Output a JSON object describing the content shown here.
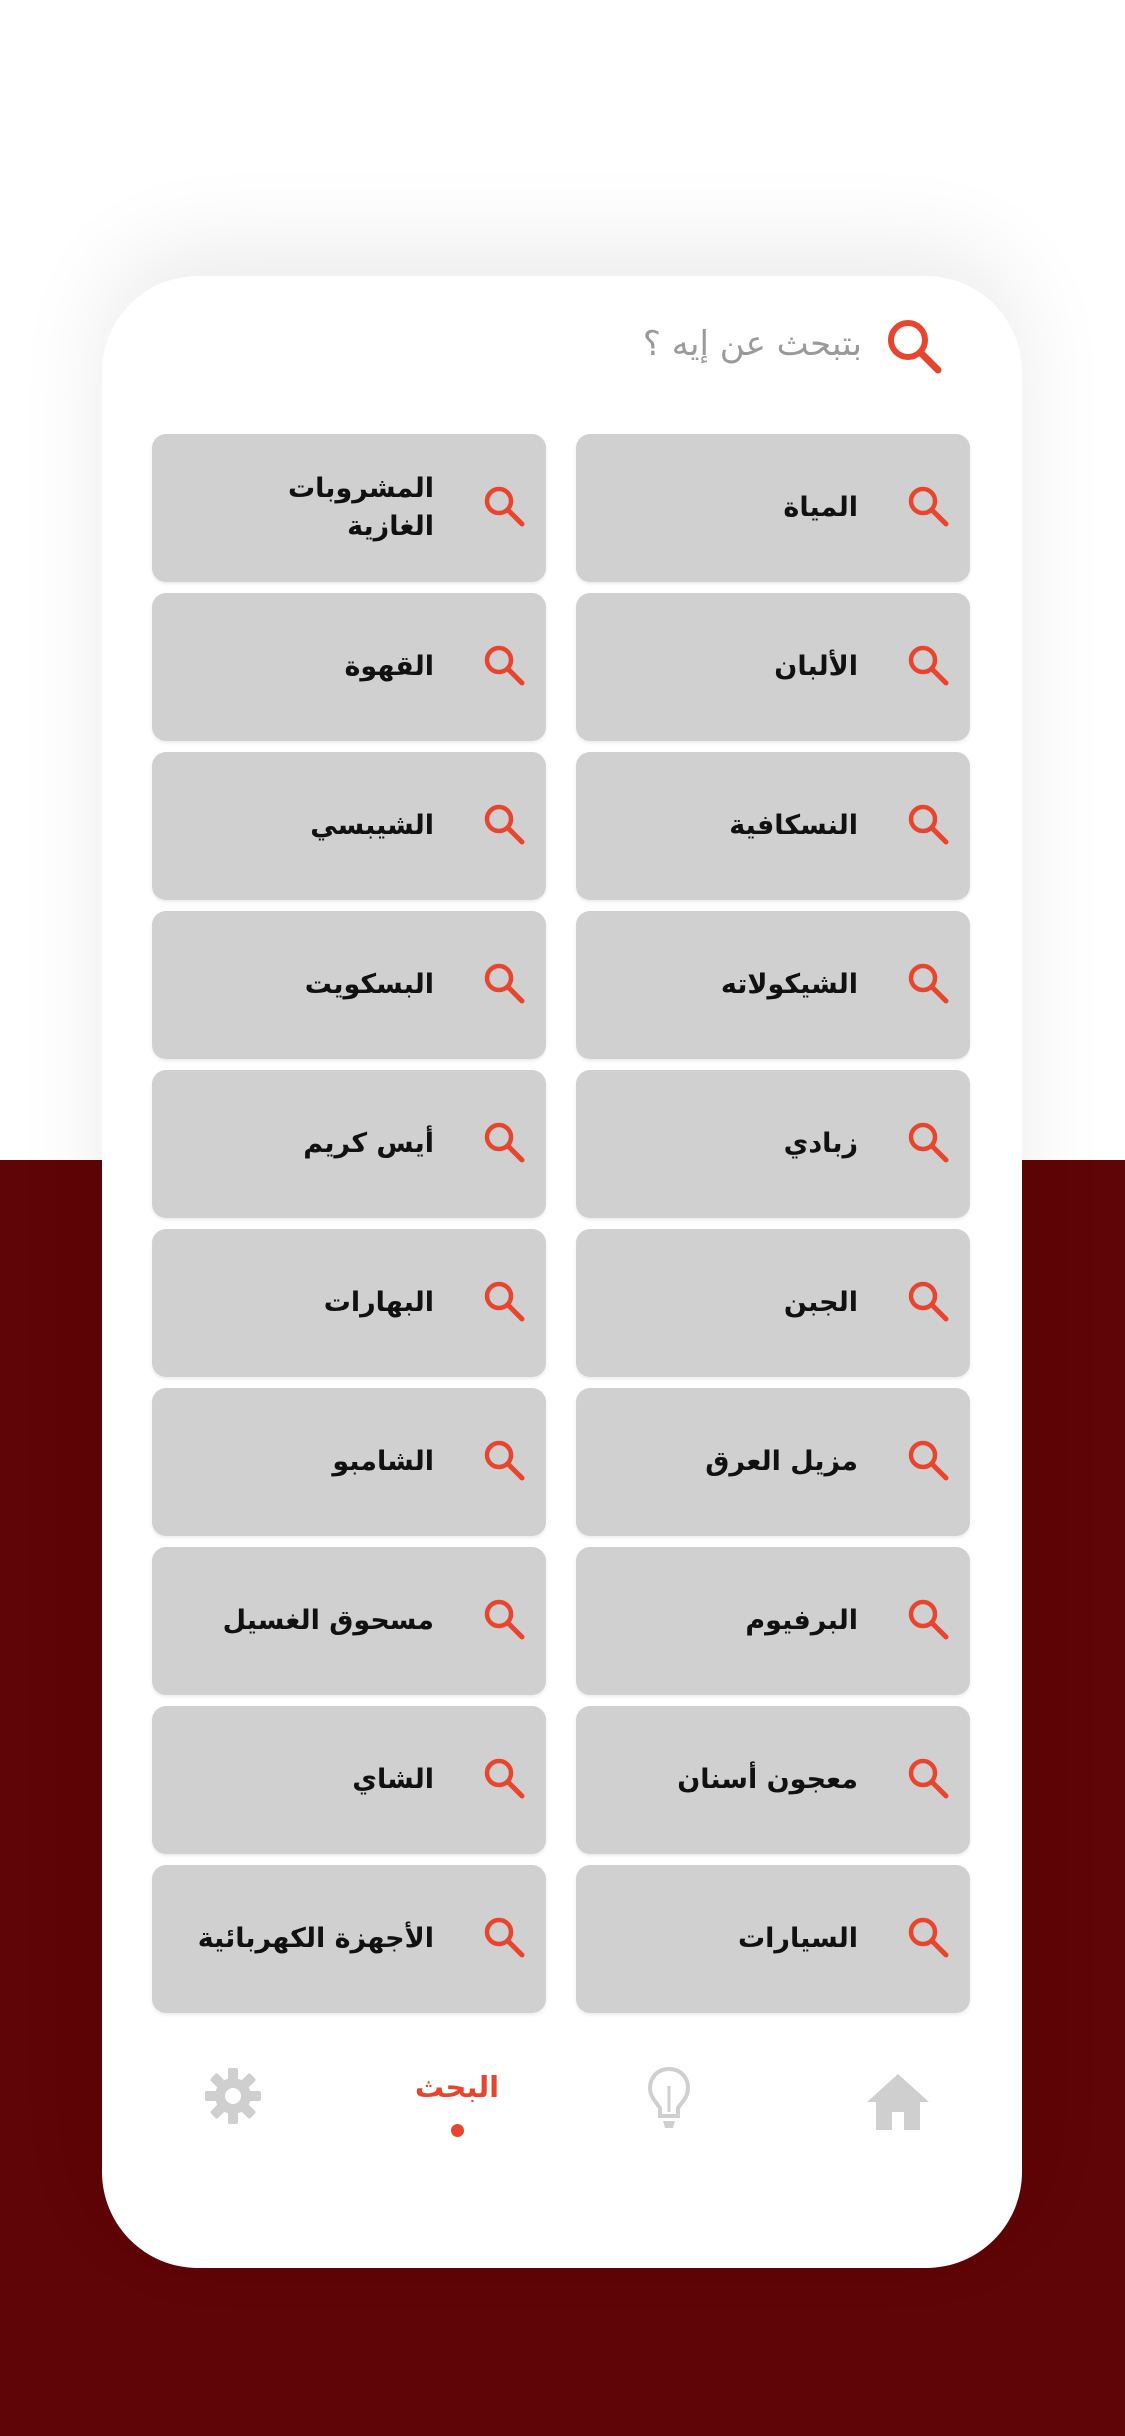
{
  "search": {
    "placeholder": "بتبحث عن إيه ؟"
  },
  "categories": [
    "المياة",
    "المشروبات الغازية",
    "الألبان",
    "القهوة",
    "النسكافية",
    "الشيبسي",
    "الشيكولاته",
    "البسكويت",
    "زبادي",
    "أيس كريم",
    "الجبن",
    "البهارات",
    "مزيل العرق",
    "الشامبو",
    "البرفيوم",
    "مسحوق الغسيل",
    "معجون أسنان",
    "الشاي",
    "السيارات",
    "الأجهزة الكهربائية"
  ],
  "nav": {
    "home_icon": "home-icon",
    "idea_icon": "lightbulb-icon",
    "search_label": "البحث",
    "settings_icon": "gear-icon"
  },
  "colors": {
    "accent": "#e8452f",
    "background_dark": "#5f0407",
    "tile": "#d0d0d0",
    "icon_inactive": "#cfcfcf"
  }
}
